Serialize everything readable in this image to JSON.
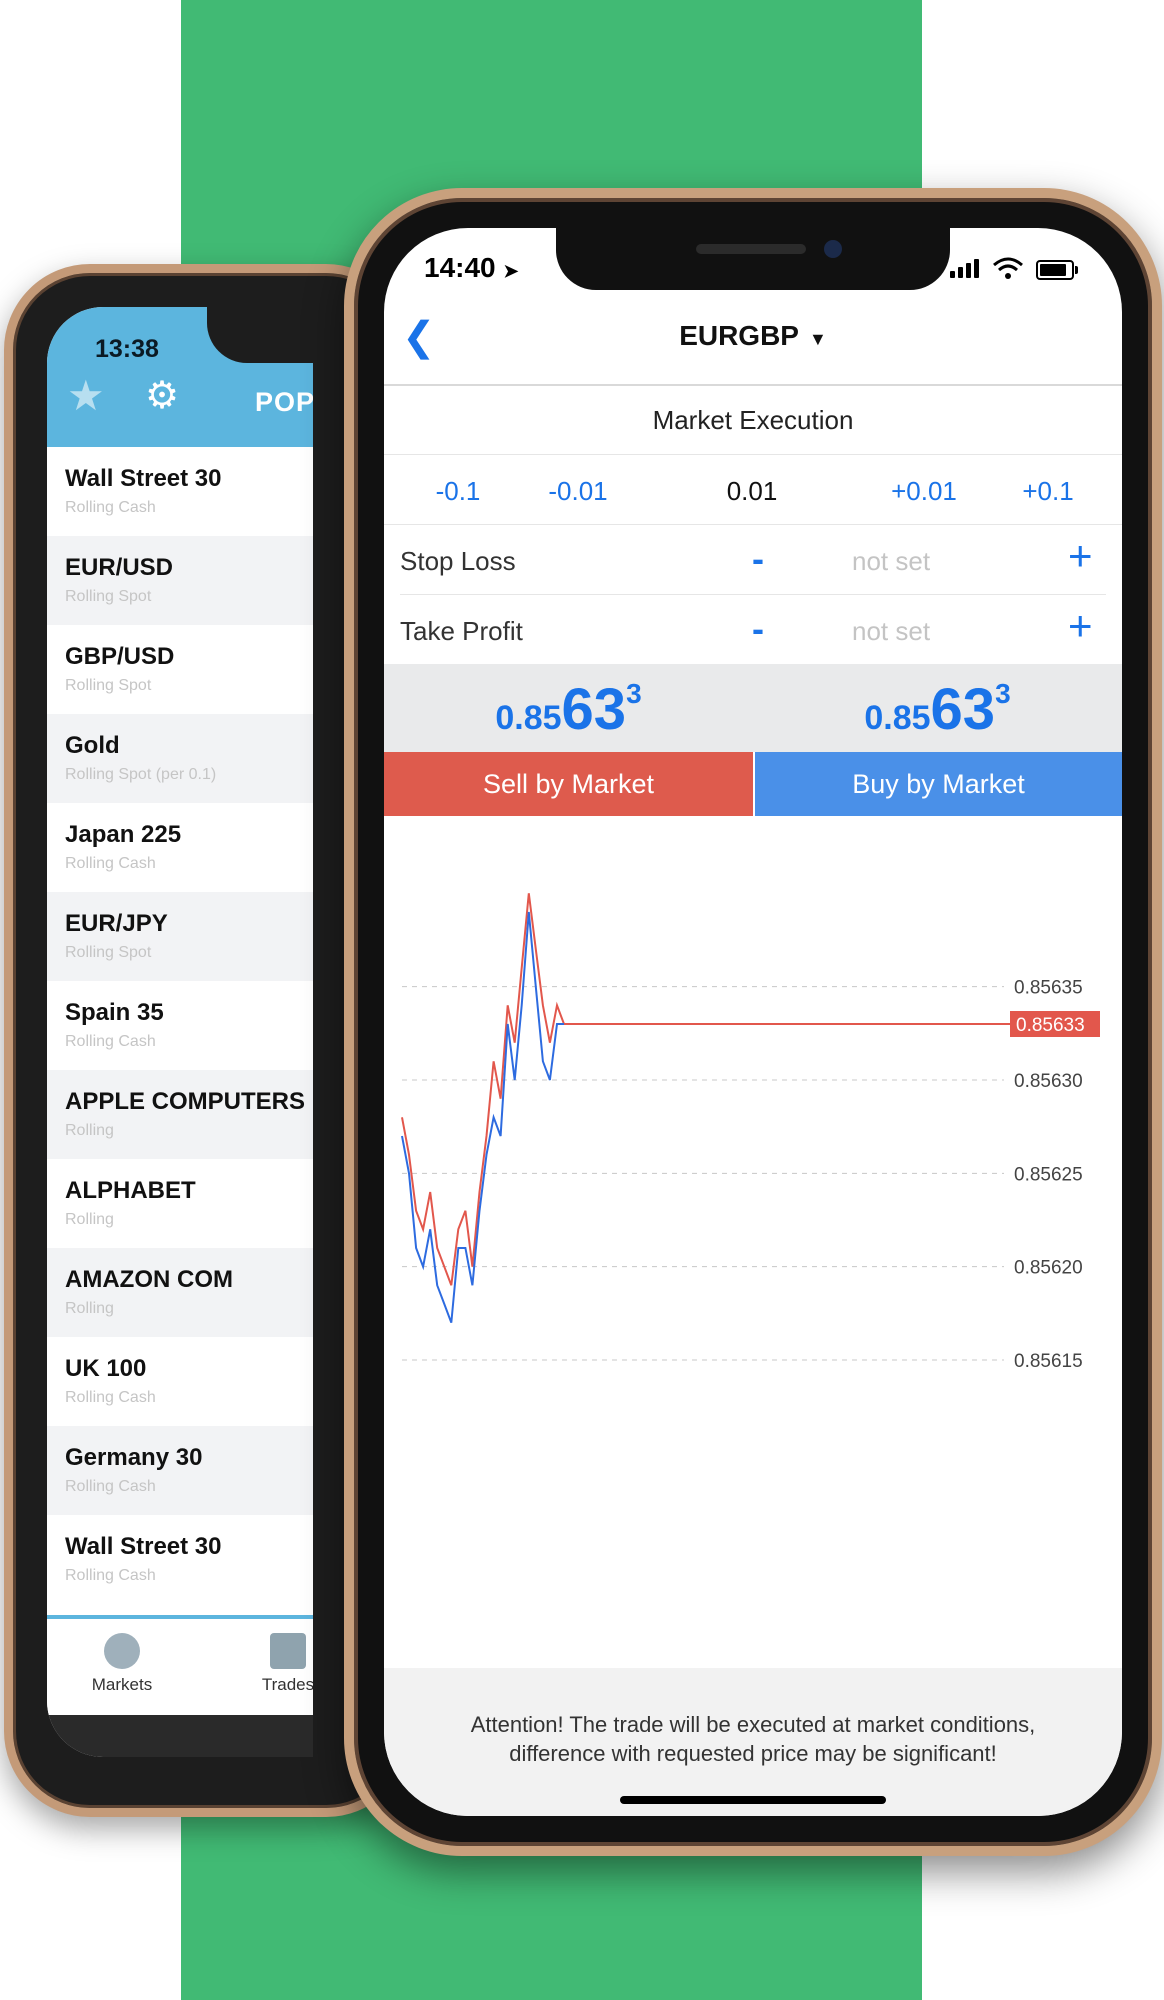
{
  "back_phone": {
    "time": "13:38",
    "header_tab": "POPULAR",
    "items": [
      {
        "name": "Wall Street 30",
        "sub": "Rolling Cash"
      },
      {
        "name": "EUR/USD",
        "sub": "Rolling Spot"
      },
      {
        "name": "GBP/USD",
        "sub": "Rolling Spot"
      },
      {
        "name": "Gold",
        "sub": "Rolling Spot (per 0.1)"
      },
      {
        "name": "Japan 225",
        "sub": "Rolling Cash"
      },
      {
        "name": "EUR/JPY",
        "sub": "Rolling Spot"
      },
      {
        "name": "Spain 35",
        "sub": "Rolling Cash"
      },
      {
        "name": "APPLE COMPUTERS INC",
        "sub": "Rolling"
      },
      {
        "name": "ALPHABET",
        "sub": "Rolling"
      },
      {
        "name": "AMAZON COM",
        "sub": "Rolling"
      },
      {
        "name": "UK 100",
        "sub": "Rolling Cash"
      },
      {
        "name": "Germany 30",
        "sub": "Rolling Cash"
      },
      {
        "name": "Wall Street 30",
        "sub": "Rolling Cash"
      }
    ],
    "tabs": {
      "markets": "Markets",
      "trades": "Trades"
    }
  },
  "front_phone": {
    "time": "14:40",
    "symbol": "EURGBP",
    "mode": "Market Execution",
    "volume": {
      "m01": "-0.1",
      "m001": "-0.01",
      "current": "0.01",
      "p001": "+0.01",
      "p01": "+0.1"
    },
    "stop_loss": {
      "label": "Stop Loss",
      "minus": "-",
      "value": "not set",
      "plus": "+"
    },
    "take_profit": {
      "label": "Take Profit",
      "minus": "-",
      "value": "not set",
      "plus": "+"
    },
    "bid": {
      "small": "0.85",
      "big": "63",
      "sup": "3"
    },
    "ask": {
      "small": "0.85",
      "big": "63",
      "sup": "3"
    },
    "sell_label": "Sell by Market",
    "buy_label": "Buy by Market",
    "attention_line1": "Attention! The trade will be executed at market conditions,",
    "attention_line2": "difference with requested price may be significant!"
  },
  "colors": {
    "accent": "#1a73e8",
    "sell": "#de5b4d",
    "buy": "#4a90e8",
    "green_bg": "#41ba74",
    "back_header": "#5cb5de"
  },
  "chart_data": {
    "type": "line",
    "ylim": [
      0.85612,
      0.85642
    ],
    "y_ticks": [
      "0.85635",
      "0.85630",
      "0.85625",
      "0.85620",
      "0.85615"
    ],
    "current_label": "0.85633",
    "current_value": 0.85633,
    "series": [
      {
        "color": "#e2574c",
        "values": [
          0.85628,
          0.85626,
          0.85623,
          0.85622,
          0.85624,
          0.85621,
          0.8562,
          0.85619,
          0.85622,
          0.85623,
          0.8562,
          0.85624,
          0.85627,
          0.85631,
          0.85629,
          0.85634,
          0.85632,
          0.85636,
          0.8564,
          0.85637,
          0.85634,
          0.85632,
          0.85634,
          0.85633
        ]
      },
      {
        "color": "#2d6be0",
        "values": [
          0.85627,
          0.85625,
          0.85621,
          0.8562,
          0.85622,
          0.85619,
          0.85618,
          0.85617,
          0.85621,
          0.85621,
          0.85619,
          0.85623,
          0.85626,
          0.85628,
          0.85627,
          0.85633,
          0.8563,
          0.85634,
          0.85639,
          0.85635,
          0.85631,
          0.8563,
          0.85633,
          0.85633
        ]
      }
    ]
  }
}
